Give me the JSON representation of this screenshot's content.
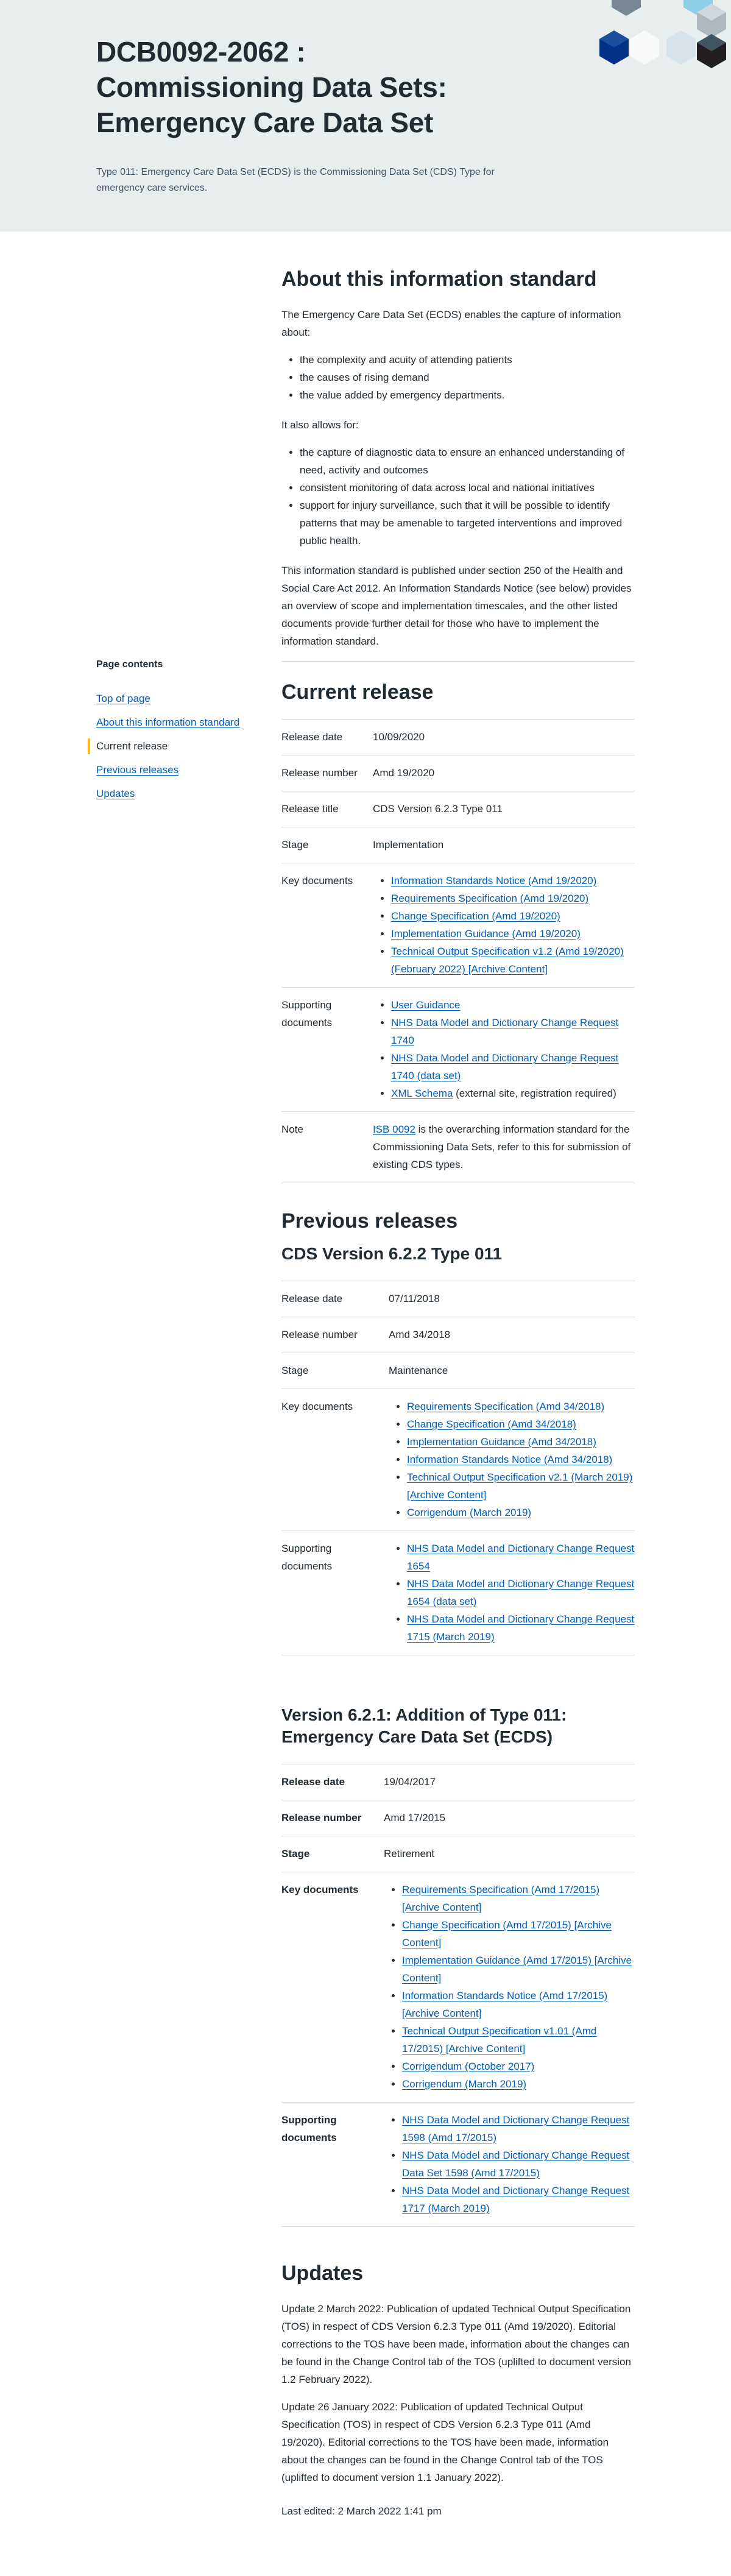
{
  "hero": {
    "title": "DCB0092-2062 : Commissioning Data Sets: Emergency Care Data Set",
    "summary": "Type 011: Emergency Care Data Set (ECDS) is the Commissioning Data Set (CDS) Type for emergency care services."
  },
  "sidebar": {
    "heading": "Page contents",
    "items": [
      {
        "label": "Top of page"
      },
      {
        "label": "About this information standard"
      },
      {
        "label": "Current release"
      },
      {
        "label": "Previous releases"
      },
      {
        "label": "Updates"
      }
    ]
  },
  "about": {
    "heading": "About this information standard",
    "intro": "The Emergency Care Data Set (ECDS) enables the capture of information about:",
    "list1": [
      "the complexity and acuity of attending patients",
      "the causes of rising demand",
      "the value added by emergency departments."
    ],
    "allows": "It also allows for:",
    "list2": [
      "the capture of diagnostic data to ensure an enhanced understanding of need, activity and outcomes",
      "consistent monitoring of data across local and national initiatives",
      "support for injury surveillance, such that it will be possible to identify patterns that may be amenable to targeted interventions and improved public health."
    ],
    "published": "This information standard is published under section 250 of the Health and Social Care Act 2012. An Information Standards Notice (see below) provides an overview of scope and implementation timescales, and the other listed documents provide further detail for those who have to implement the information standard."
  },
  "current": {
    "heading": "Current release",
    "rows": {
      "release_date": {
        "label": "Release date",
        "value": "10/09/2020"
      },
      "release_number": {
        "label": "Release number",
        "value": "Amd 19/2020"
      },
      "release_title": {
        "label": "Release title",
        "value": "CDS Version 6.2.3 Type 011"
      },
      "stage": {
        "label": "Stage",
        "value": "Implementation"
      }
    },
    "key_label": "Key documents",
    "key_docs": [
      "Information Standards Notice (Amd 19/2020)",
      "Requirements Specification (Amd 19/2020)",
      "Change Specification (Amd 19/2020)",
      "Implementation Guidance (Amd 19/2020)",
      "Technical Output Specification v1.2 (Amd 19/2020) (February 2022) [Archive Content]"
    ],
    "supporting_label": "Supporting documents",
    "supporting": {
      "user_guidance": "User Guidance",
      "cr1740": "NHS Data Model and Dictionary Change Request 1740",
      "cr1740_ds": "NHS Data Model and Dictionary Change Request 1740 (data set)",
      "xml_link": "XML Schema",
      "xml_note": " (external site, registration required)"
    },
    "note_label": "Note",
    "note_link": "ISB 0092",
    "note_text": " is the overarching information standard for the Commissioning Data Sets, refer to this for submission of existing CDS types."
  },
  "previous": {
    "heading": "Previous releases",
    "v622": {
      "title": "CDS Version 6.2.2 Type 011",
      "release_date": {
        "label": "Release date",
        "value": "07/11/2018"
      },
      "release_number": {
        "label": "Release number",
        "value": "Amd 34/2018"
      },
      "stage": {
        "label": "Stage",
        "value": "Maintenance"
      },
      "key_label": "Key documents",
      "key_docs": [
        "Requirements Specification (Amd 34/2018)",
        "Change Specification (Amd 34/2018)",
        "Implementation Guidance (Amd 34/2018)",
        "Information Standards Notice (Amd 34/2018)",
        "Technical Output Specification v2.1 (March 2019) [Archive Content]",
        "Corrigendum (March 2019)"
      ],
      "supporting_label": "Supporting documents",
      "supporting": [
        "NHS Data Model and Dictionary Change Request 1654",
        "NHS Data Model and Dictionary Change Request 1654 (data set)",
        "NHS Data Model and Dictionary Change Request 1715 (March 2019)"
      ]
    },
    "v621": {
      "title": "Version 6.2.1: Addition of Type 011: Emergency Care Data Set (ECDS)",
      "release_date": {
        "label": "Release date",
        "value": "19/04/2017"
      },
      "release_number": {
        "label": "Release number",
        "value": "Amd 17/2015"
      },
      "stage": {
        "label": "Stage",
        "value": "Retirement"
      },
      "key_label": "Key documents",
      "key_docs": [
        "Requirements Specification (Amd 17/2015) [Archive Content]",
        "Change Specification (Amd 17/2015) [Archive Content]",
        "Implementation Guidance (Amd 17/2015) [Archive Content]",
        "Information Standards Notice (Amd 17/2015) [Archive Content]",
        "Technical Output Specification v1.01 (Amd 17/2015) [Archive Content]",
        "Corrigendum (October 2017)",
        "Corrigendum (March 2019)"
      ],
      "supporting_label": "Supporting documents",
      "supporting": [
        "NHS Data Model and Dictionary Change Request 1598 (Amd 17/2015)",
        "NHS Data Model and Dictionary Change Request Data Set 1598 (Amd 17/2015)",
        "NHS Data Model and Dictionary Change Request 1717 (March 2019)"
      ]
    }
  },
  "updates": {
    "heading": "Updates",
    "items": [
      "Update 2 March 2022: Publication of updated Technical Output Specification (TOS) in respect of CDS Version 6.2.3 Type 011 (Amd 19/2020).  Editorial corrections to the TOS have been made, information about the changes can be found in the Change Control tab of the TOS (uplifted to document version 1.2 February 2022).",
      "Update 26 January 2022: Publication of updated Technical Output Specification (TOS) in respect of CDS Version 6.2.3 Type 011 (Amd 19/2020).  Editorial corrections to the TOS have been made, information about the changes can be found in the Change Control tab of the TOS (uplifted to document version 1.1 January 2022)."
    ],
    "last_edited": "Last edited: 2 March 2022 1:41 pm"
  }
}
